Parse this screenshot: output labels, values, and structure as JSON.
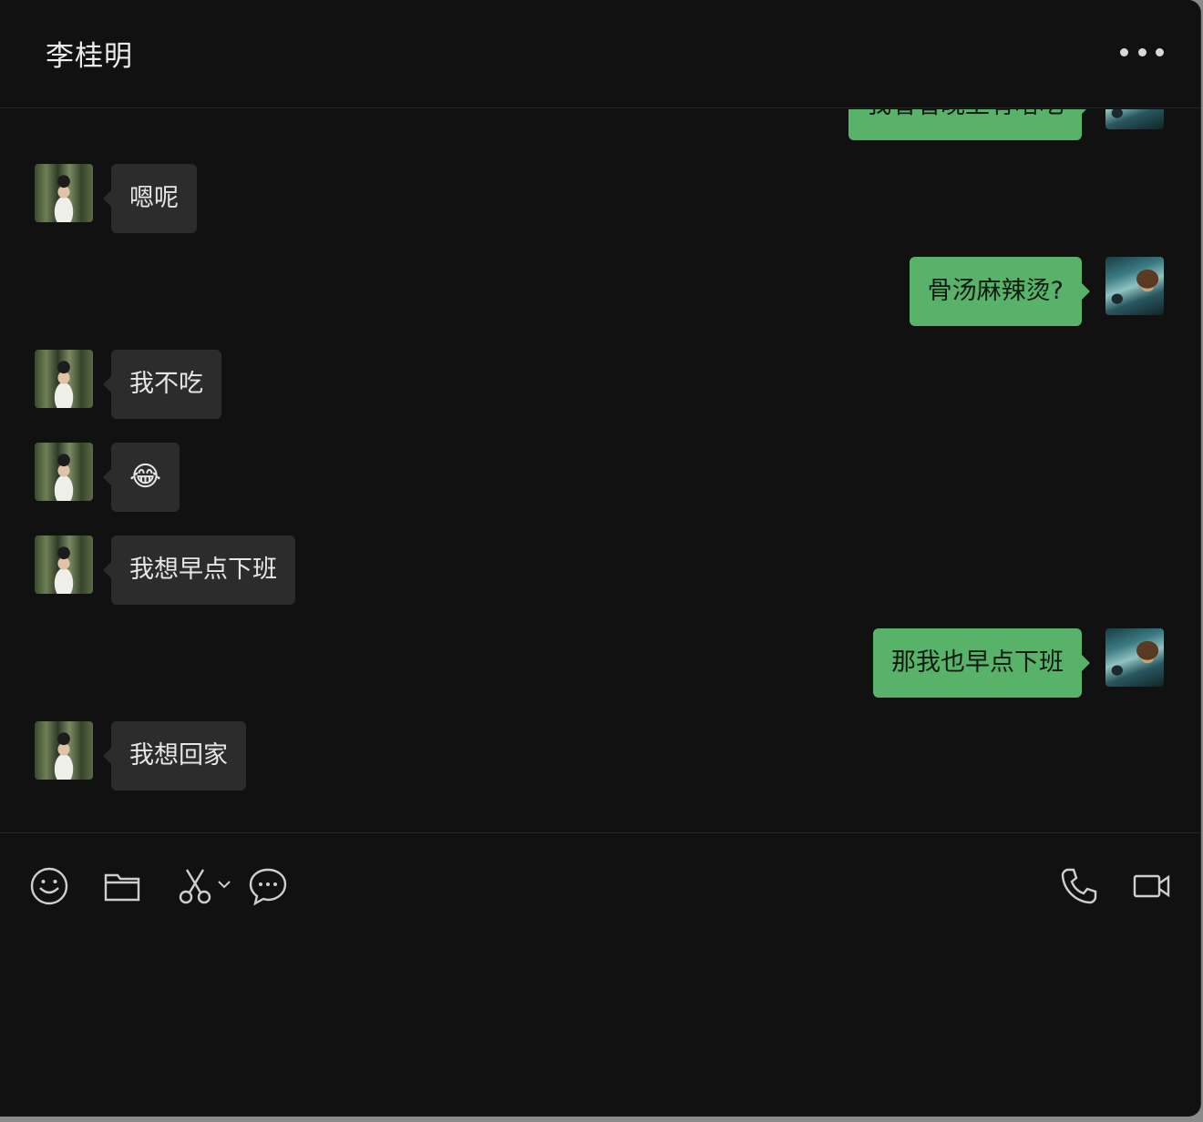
{
  "header": {
    "title": "李桂明",
    "more_icon": "more-dots-icon"
  },
  "messages": [
    {
      "side": "out",
      "text": "我看看晚上有啥吃"
    },
    {
      "side": "in",
      "text": "嗯呢"
    },
    {
      "side": "out",
      "text": "骨汤麻辣烫?"
    },
    {
      "side": "in",
      "text": "我不吃"
    },
    {
      "side": "in",
      "text": "😂"
    },
    {
      "side": "in",
      "text": "我想早点下班"
    },
    {
      "side": "out",
      "text": "那我也早点下班"
    },
    {
      "side": "in",
      "text": "我想回家"
    }
  ],
  "toolbar": {
    "left": [
      "emoji-icon",
      "folder-icon",
      "scissors-icon",
      "chat-bubble-icon"
    ],
    "right": [
      "phone-icon",
      "video-camera-icon"
    ]
  },
  "colors": {
    "background": "#111111",
    "incoming_bubble": "#2c2c2c",
    "outgoing_bubble": "#59b269",
    "text_light": "#e6e6e6"
  }
}
